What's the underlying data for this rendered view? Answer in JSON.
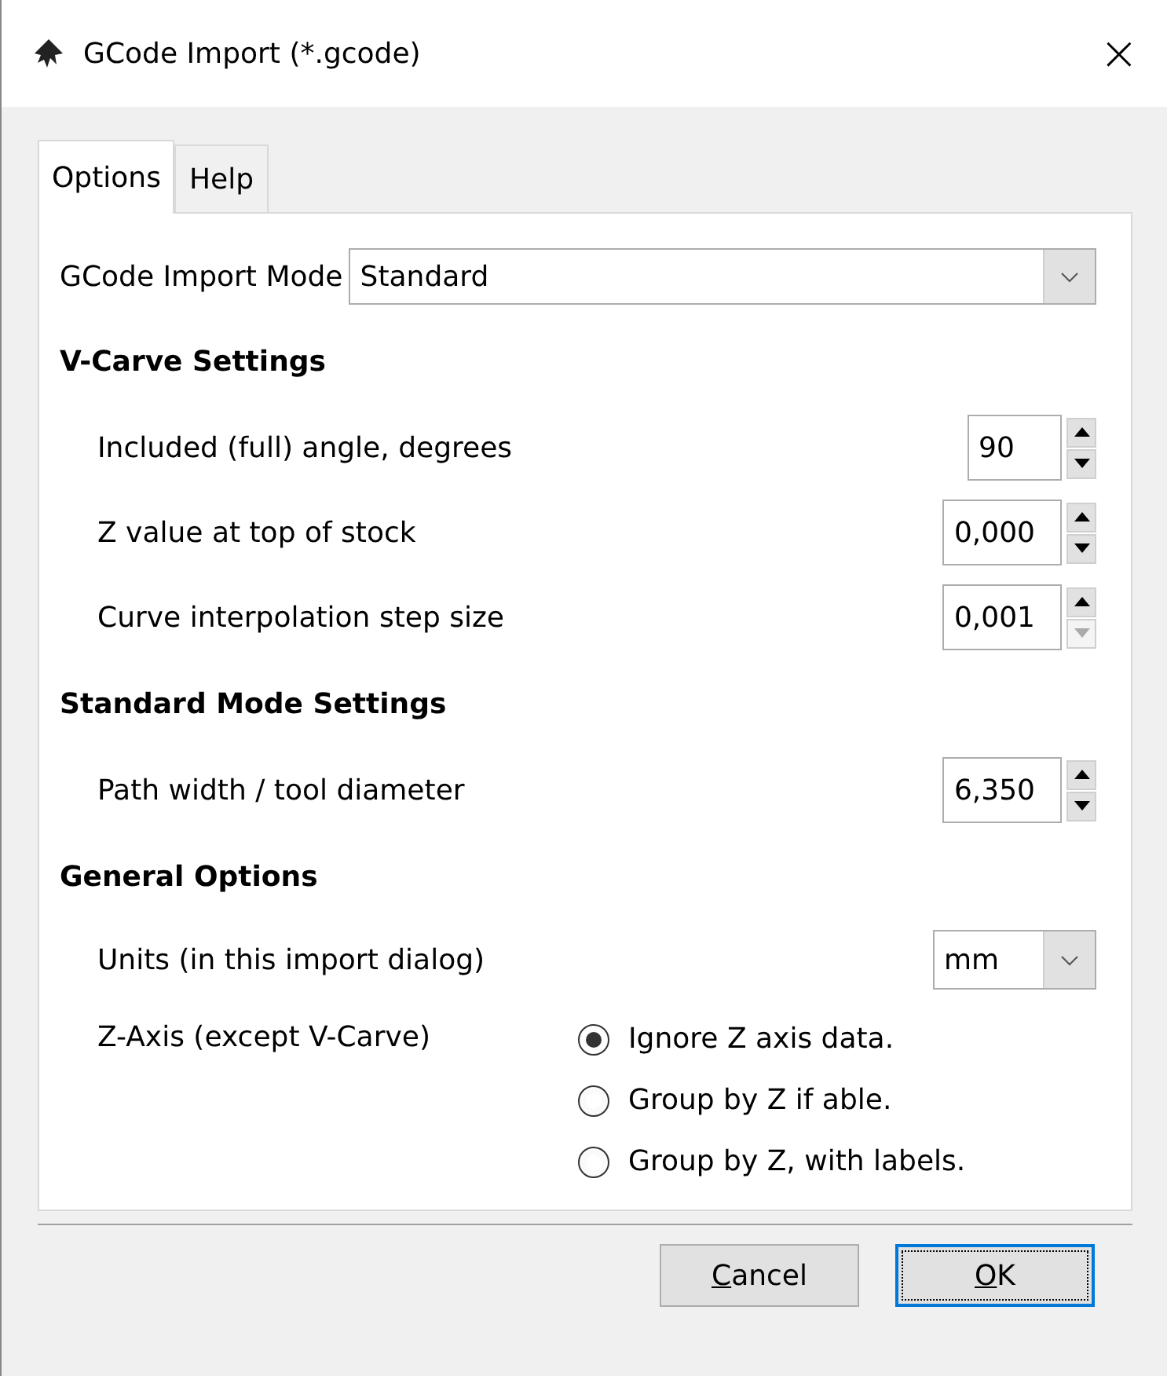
{
  "window": {
    "title": "GCode Import (*.gcode)",
    "close": "×"
  },
  "tabs": [
    {
      "label": "Options",
      "selected": true
    },
    {
      "label": "Help",
      "selected": false
    }
  ],
  "mode": {
    "label": "GCode Import Mode",
    "value": "Standard"
  },
  "sections": [
    {
      "heading": "V-Carve Settings",
      "rows": [
        {
          "label": "Included (full) angle, degrees",
          "value": "90",
          "down_disabled": false
        },
        {
          "label": "Z value at top of stock",
          "value": "0,000",
          "down_disabled": false
        },
        {
          "label": "Curve interpolation step size",
          "value": "0,001",
          "down_disabled": true
        }
      ]
    },
    {
      "heading": "Standard Mode Settings",
      "rows": [
        {
          "label": "Path width / tool diameter",
          "value": "6,350",
          "down_disabled": false
        }
      ]
    },
    {
      "heading": "General Options"
    }
  ],
  "units": {
    "label": "Units (in this import dialog)",
    "value": "mm"
  },
  "z_axis": {
    "label": "Z-Axis (except V-Carve)",
    "options": [
      {
        "label": "Ignore Z axis data.",
        "selected": true
      },
      {
        "label": "Group by Z if able.",
        "selected": false
      },
      {
        "label": "Group by Z, with labels.",
        "selected": false
      }
    ]
  },
  "buttons": [
    {
      "accel": "C",
      "rest": "ancel",
      "default": false
    },
    {
      "accel": "O",
      "rest": "K",
      "default": true
    }
  ]
}
